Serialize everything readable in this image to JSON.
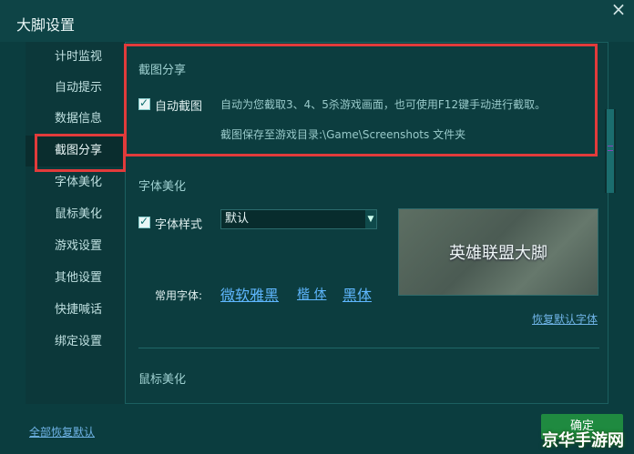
{
  "window": {
    "title": "大脚设置",
    "close_glyph": "×"
  },
  "sidebar": {
    "items": [
      {
        "label": "计时监视"
      },
      {
        "label": "自动提示"
      },
      {
        "label": "数据信息"
      },
      {
        "label": "截图分享"
      },
      {
        "label": "字体美化"
      },
      {
        "label": "鼠标美化"
      },
      {
        "label": "游戏设置"
      },
      {
        "label": "其他设置"
      },
      {
        "label": "快捷喊话"
      },
      {
        "label": "绑定设置"
      }
    ]
  },
  "screenshot": {
    "title": "截图分享",
    "checkbox_label": "自动截图",
    "desc_line1": "自动为您截取3、4、5杀游戏画面，也可使用F12键手动进行截取。",
    "desc_line2": "截图保存至游戏目录:\\Game\\Screenshots 文件夹"
  },
  "font": {
    "title": "字体美化",
    "checkbox_label": "字体样式",
    "select_value": "默认",
    "select_arrow": "▼",
    "common_label": "常用字体:",
    "options": [
      "微软雅黑",
      "楷 体",
      "黑体"
    ],
    "preview_text": "英雄联盟大脚",
    "restore_link": "恢复默认字体"
  },
  "mouse": {
    "title": "鼠标美化"
  },
  "footer": {
    "restore_all": "全部恢复默认",
    "confirm_label": "确定",
    "watermark": "京华手游网"
  }
}
